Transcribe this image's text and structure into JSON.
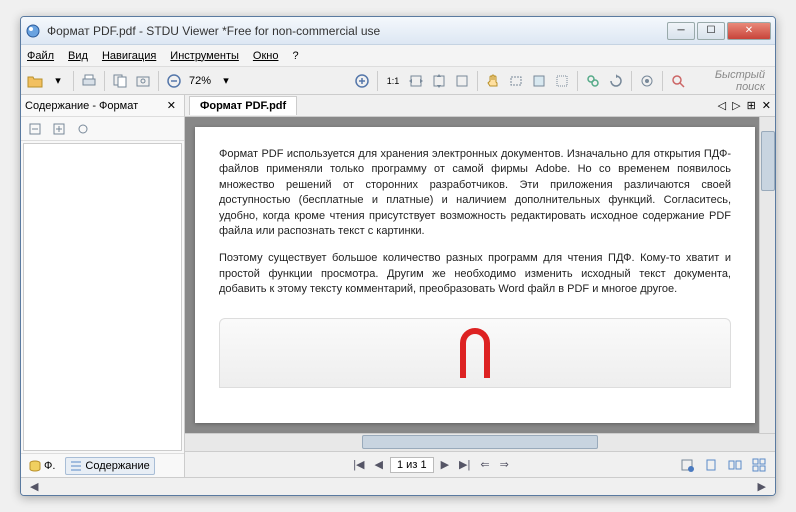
{
  "title": "Формат PDF.pdf - STDU Viewer *Free for non-commercial use",
  "menu": {
    "file": "Файл",
    "view": "Вид",
    "navigation": "Навигация",
    "tools": "Инструменты",
    "window": "Окно",
    "help": "?"
  },
  "toolbar": {
    "zoom": "72%",
    "quick_search": "Быстрый поиск"
  },
  "sidebar": {
    "header": "Содержание - Формат",
    "tabs": {
      "favorites": "Ф.",
      "contents": "Содержание"
    }
  },
  "doc": {
    "tab_title": "Формат PDF.pdf",
    "para1": "Формат PDF используется для хранения электронных документов. Изначально для открытия ПДФ-файлов применяли только программу от самой фирмы Adobe. Но со временем появилось множество решений от сторонних разработчиков. Эти приложения различаются своей доступностью (бесплатные и платные) и наличием дополнительных функций. Согласитесь, удобно, когда кроме чтения присутствует возможность редактировать исходное содержание PDF файла или распознать текст с картинки.",
    "para2": "Поэтому существует большое количество разных программ для чтения ПДФ. Кому-то хватит и простой функции просмотра. Другим же необходимо изменить исходный текст документа, добавить к этому тексту комментарий, преобразовать Word файл в PDF и многое другое."
  },
  "nav": {
    "page_current": "1",
    "page_sep": "из",
    "page_total": "1"
  }
}
